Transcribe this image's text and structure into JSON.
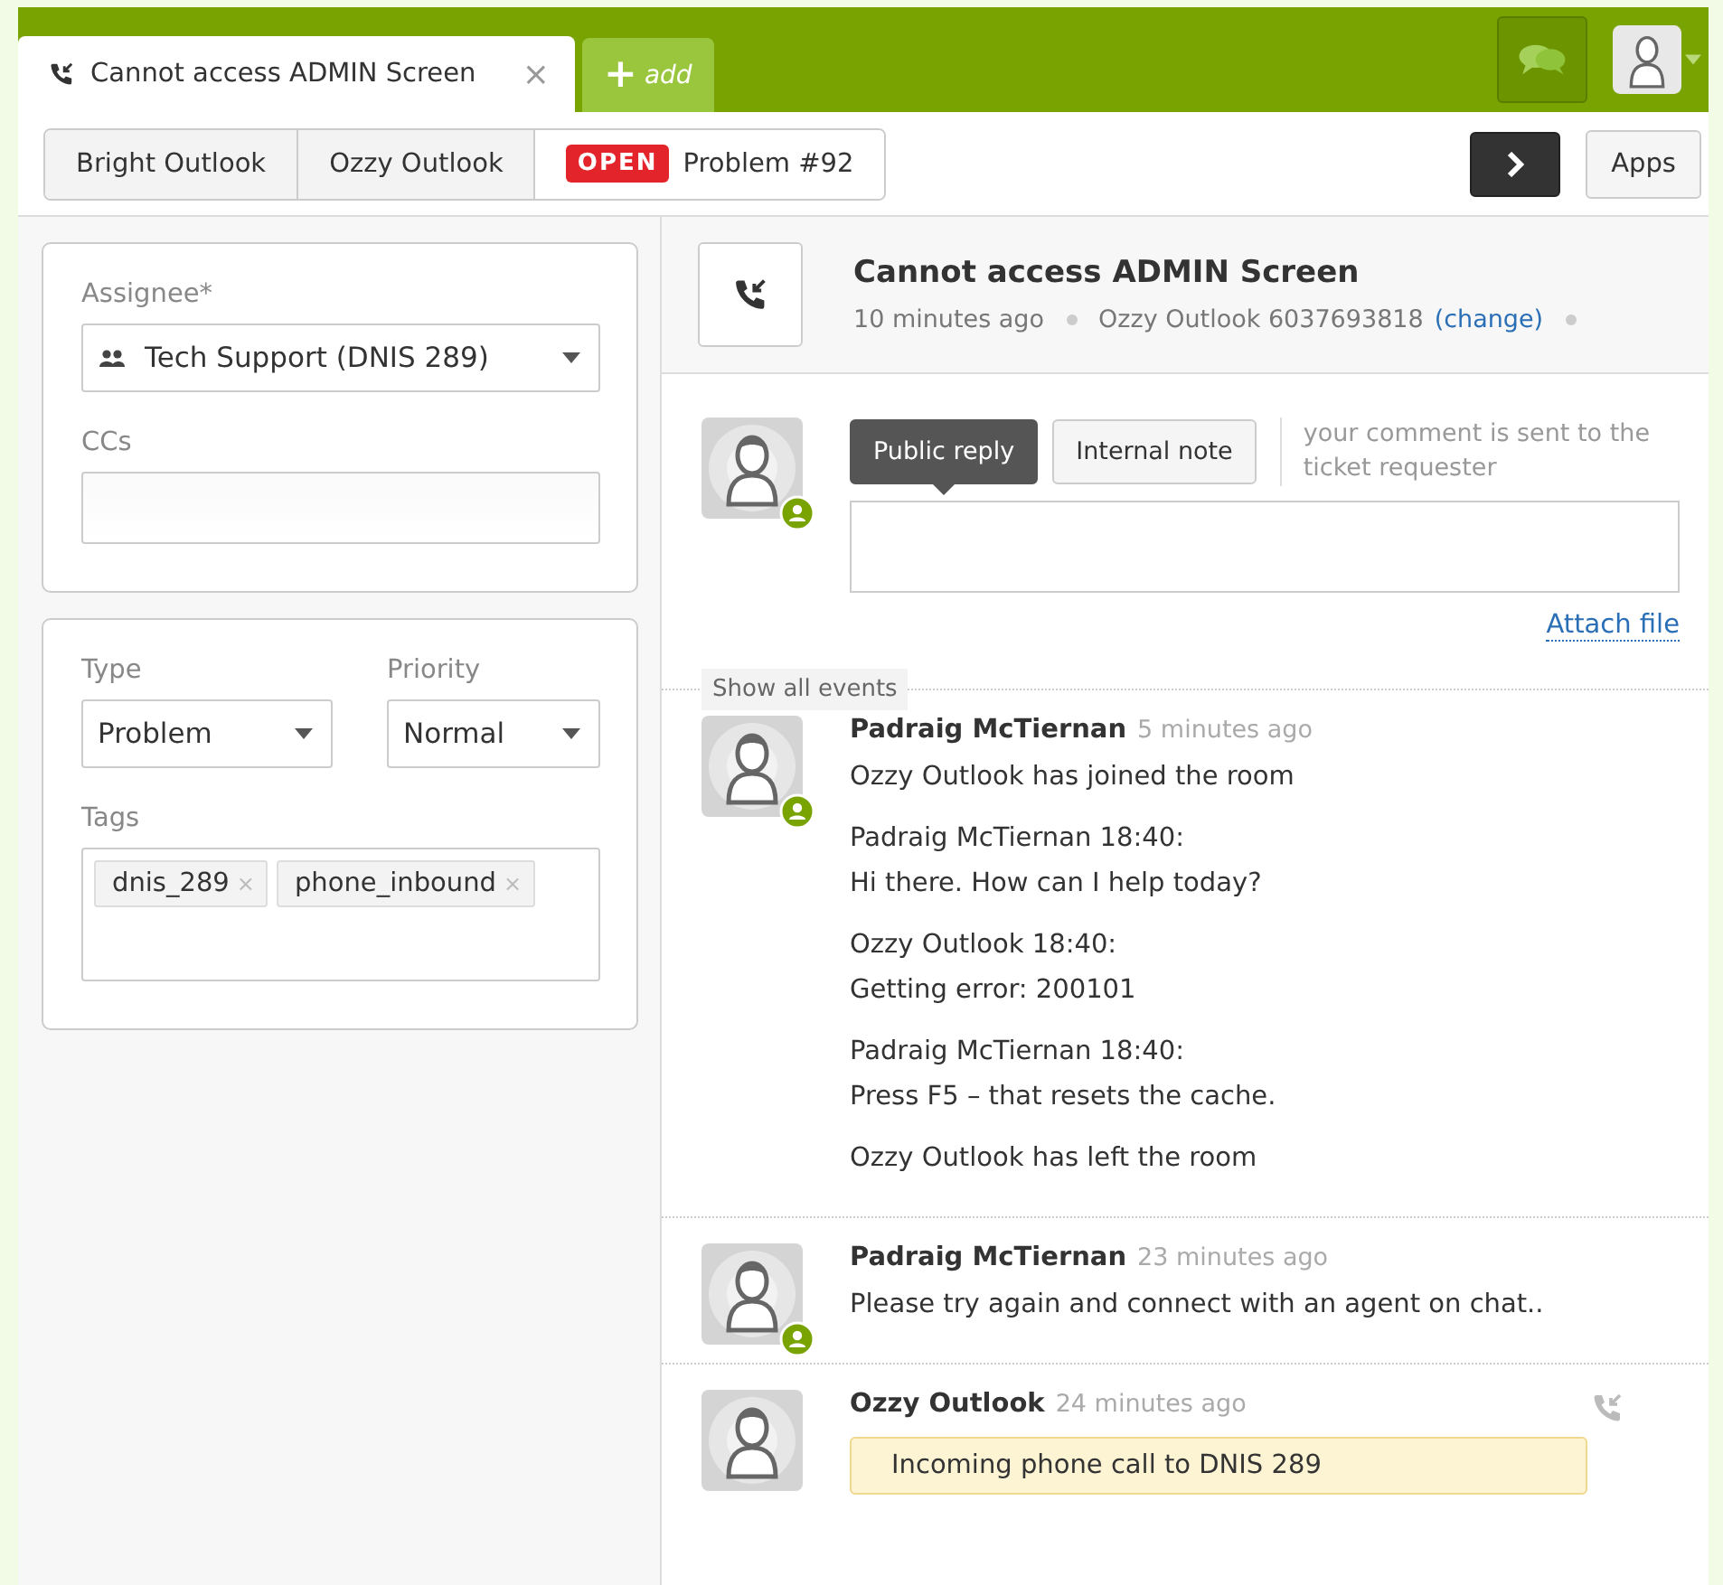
{
  "top_tabs": [
    {
      "label": "Cannot access ADMIN Screen",
      "selected": true,
      "kind": "ticket",
      "close": "×"
    },
    {
      "label": "add",
      "selected": false,
      "kind": "add",
      "glyph": "+"
    }
  ],
  "breadcrumbs": [
    {
      "label": "Bright Outlook",
      "selected": false
    },
    {
      "label": "Ozzy Outlook",
      "selected": false
    },
    {
      "label": "Problem #92",
      "selected": true,
      "status": "OPEN"
    }
  ],
  "apps_button": "Apps",
  "properties": {
    "assignee": {
      "label": "Assignee*",
      "value": "Tech Support (DNIS 289)"
    },
    "ccs": {
      "label": "CCs"
    },
    "type": {
      "label": "Type",
      "value": "Problem"
    },
    "priority": {
      "label": "Priority",
      "value": "Normal"
    },
    "tags": {
      "label": "Tags",
      "items": [
        {
          "label": "dnis_289",
          "remove": "×"
        },
        {
          "label": "phone_inbound",
          "remove": "×"
        }
      ]
    }
  },
  "ticket": {
    "title": "Cannot access ADMIN Screen",
    "time": "10 minutes ago",
    "requester": "Ozzy Outlook 6037693818",
    "change_link": "(change)"
  },
  "composer": {
    "modes": [
      {
        "label": "Public reply",
        "selected": true
      },
      {
        "label": "Internal note",
        "selected": false
      }
    ],
    "hint": "your comment is sent to the ticket requester",
    "attach": "Attach file",
    "online": true
  },
  "show_all": "Show all events",
  "events": [
    {
      "kind": "message",
      "author": "Padraig McTiernan",
      "time": "5 minutes ago",
      "online": true,
      "paragraphs": [
        [
          "Ozzy Outlook has joined the room"
        ],
        [
          "Padraig McTiernan 18:40:",
          "Hi there. How can I help today?"
        ],
        [
          "Ozzy Outlook 18:40:",
          "Getting error: 200101"
        ],
        [
          "Padraig McTiernan 18:40:",
          "Press F5 – that resets the cache."
        ],
        [
          "Ozzy Outlook has left the room"
        ]
      ]
    },
    {
      "kind": "message",
      "author": "Padraig McTiernan",
      "time": "23 minutes ago",
      "online": true,
      "paragraphs": [
        [
          "Please try again and connect with an agent on chat.."
        ]
      ]
    },
    {
      "kind": "call",
      "author": "Ozzy Outlook",
      "time": "24 minutes ago",
      "online": false,
      "note": "Incoming phone call to DNIS 289"
    }
  ]
}
